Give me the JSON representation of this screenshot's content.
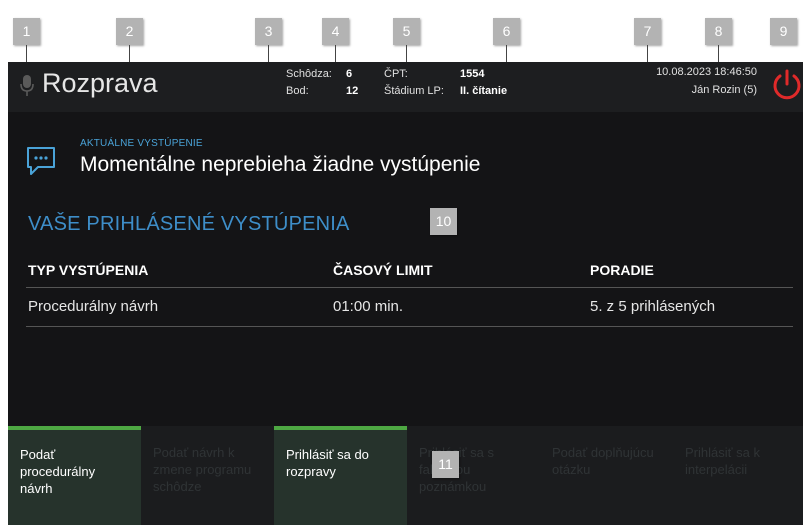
{
  "header": {
    "title": "Rozprava",
    "schodza_label": "Schôdza:",
    "schodza_value": "6",
    "bod_label": "Bod:",
    "bod_value": "12",
    "cpt_label": "ČPT:",
    "cpt_value": "1554",
    "stadium_label": "Štádium LP:",
    "stadium_value": "II. čítanie",
    "datetime": "10.08.2023 18:46:50",
    "user": "Ján Rozin (5)"
  },
  "current": {
    "label": "AKTUÁLNE VYSTÚPENIE",
    "value": "Momentálne neprebieha žiadne vystúpenie"
  },
  "registered": {
    "title": "VAŠE PRIHLÁSENÉ VYSTÚPENIA",
    "columns": [
      "TYP VYSTÚPENIA",
      "ČASOVÝ LIMIT",
      "PORADIE"
    ],
    "rows": [
      [
        "Procedurálny návrh",
        "01:00 min.",
        "5. z 5 prihlásených"
      ]
    ]
  },
  "buttons": [
    {
      "label": "Podať procedurálny návrh",
      "state": "active"
    },
    {
      "label": "Podať návrh k zmene programu schôdze",
      "state": "disabled"
    },
    {
      "label": "Prihlásiť sa do rozpravy",
      "state": "active"
    },
    {
      "label": "Prihlásiť sa s faktickou poznámkou",
      "state": "disabled"
    },
    {
      "label": "Podať doplňujúcu otázku",
      "state": "disabled"
    },
    {
      "label": "Prihlásiť sa k interpelácii",
      "state": "disabled"
    }
  ],
  "callouts": [
    "1",
    "2",
    "3",
    "4",
    "5",
    "6",
    "7",
    "8",
    "9",
    "10",
    "11"
  ],
  "colors": {
    "accent_blue": "#3e8ec9",
    "active_green": "#4ea843",
    "power_red": "#e02a2a",
    "background": "#141416"
  },
  "icons": {
    "mic": "microphone-icon",
    "power": "power-icon",
    "speech": "speech-bubble-icon"
  }
}
